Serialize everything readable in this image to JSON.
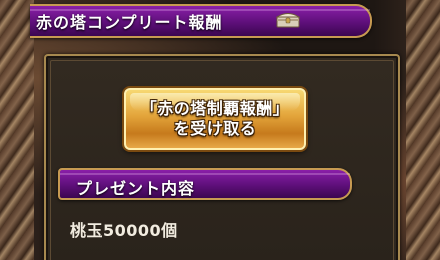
{
  "header": {
    "title": "赤の塔コンプリート報酬",
    "icon": "treasure-chest-icon"
  },
  "claim_button": {
    "line1": "「赤の塔制覇報酬」",
    "line2": "を受け取る"
  },
  "present_section": {
    "title": "プレゼント内容",
    "items": [
      {
        "label": "桃玉50000個"
      }
    ]
  },
  "colors": {
    "banner_purple": "#5e0f7a",
    "banner_border_gold": "#c79a52",
    "button_gold": "#e3a43a",
    "panel_bg": "#2e271f"
  }
}
